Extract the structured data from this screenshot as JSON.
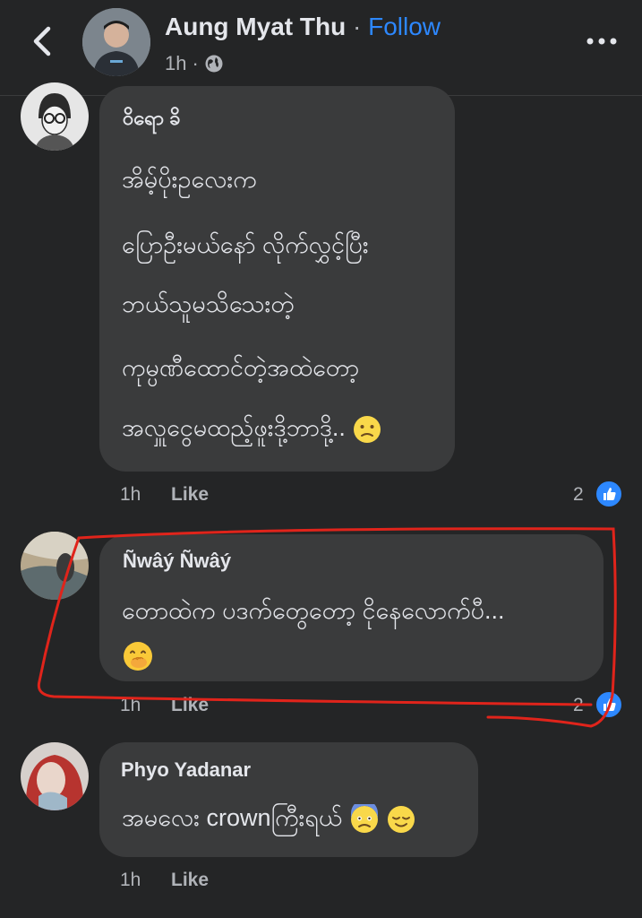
{
  "header": {
    "author_name": "Aung Myat Thu",
    "separator": "·",
    "follow_label": "Follow",
    "time": "1h",
    "meta_separator": "·",
    "privacy_icon": "globe-icon",
    "back_icon": "chevron-left-icon",
    "more_icon": "more-dots-icon"
  },
  "comments": [
    {
      "author": "ဝိရော ခိ",
      "lines": [
        "အိမ့်ပိုးဥလေးက",
        "ပြောဦးမယ်နော် လိုက်လွှင့်ပြီး",
        "ဘယ်သူမသိသေးတဲ့",
        "ကုမ္ပဏီထောင်တဲ့အထဲတော့",
        "အလှူငွေမထည့်ဖူးဒို့ဘာဒို့.."
      ],
      "emoji": "slightly-frowning-face",
      "time": "1h",
      "like_label": "Like",
      "reaction_count": "2"
    },
    {
      "author": "Ñwâý Ñwâý",
      "lines": [
        "တောထဲက ပဒက်တွေတော့ ငိုနေလောက်ပီ..."
      ],
      "emoji": "face-with-hand-over-mouth",
      "time": "1h",
      "like_label": "Like",
      "reaction_count": "2",
      "annotated": true
    },
    {
      "author": "Phyo Yadanar",
      "lines": [
        "အမလေး crownကြီးရယ်"
      ],
      "emoji": [
        "anxious-face",
        "relieved-face"
      ],
      "time": "1h",
      "like_label": "Like"
    }
  ],
  "colors": {
    "background": "#242526",
    "bubble": "#3a3b3c",
    "accent": "#2d88ff",
    "secondary_text": "#b0b3b8",
    "annotation": "#e0241b"
  }
}
